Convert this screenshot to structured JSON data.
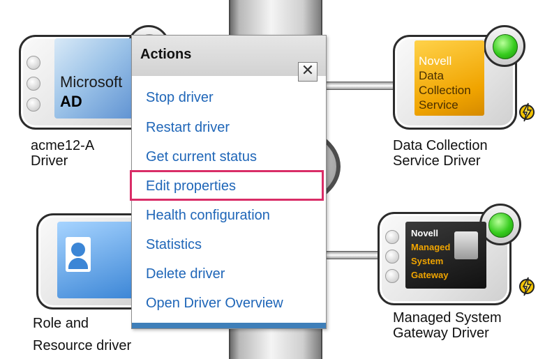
{
  "popup": {
    "title": "Actions",
    "close_glyph": "✕",
    "items": [
      "Stop driver",
      "Restart driver",
      "Get current status",
      "Edit properties",
      "Health configuration",
      "Statistics",
      "Delete driver",
      "Open Driver Overview"
    ],
    "highlighted_item": "Edit properties",
    "highlight_color": "#d92d67"
  },
  "drivers": {
    "ad": {
      "tile_line1": "Microsoft",
      "tile_line2": "AD",
      "label_line1": "acme12-A",
      "label_line2": "Driver",
      "status": "unknown"
    },
    "dcs": {
      "tile_lines": [
        "Novell",
        "Data",
        "Collection",
        "Service"
      ],
      "label_line1": "Data Collection",
      "label_line2": "Service Driver",
      "status": "running"
    },
    "role": {
      "label_line1": "Role and",
      "label_line2": "Resource driver",
      "status": "unknown"
    },
    "msg": {
      "tile_lines": [
        "Novell",
        "Managed",
        "System",
        "Gateway"
      ],
      "label_line1": "Managed System",
      "label_line2": "Gateway Driver",
      "status": "running"
    }
  },
  "icons": {
    "status_running": "green-status-light-icon",
    "driver_flag": "gear-lightning-icon"
  },
  "colors": {
    "link": "#1f66b8",
    "status_green": "#36cc1e",
    "dcs_tile": "#f0a400",
    "msg_highlight": "#f0a400"
  }
}
